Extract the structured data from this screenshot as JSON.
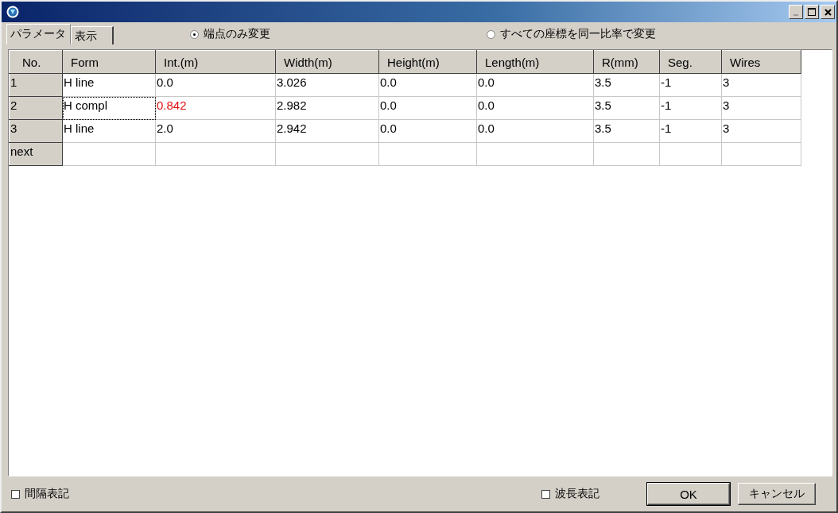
{
  "window": {
    "controls": [
      {
        "kind": "minimize",
        "disabled": true
      },
      {
        "kind": "maximize",
        "disabled": false
      },
      {
        "kind": "close",
        "disabled": false
      }
    ]
  },
  "tabs": [
    {
      "label": "パラメータ",
      "selected": true
    },
    {
      "label": "表示",
      "selected": false
    }
  ],
  "modes": [
    {
      "label": "端点のみ変更",
      "selected": true
    },
    {
      "label": "すべての座標を同一比率で変更",
      "selected": false
    }
  ],
  "table": {
    "columns": [
      "No.",
      "Form",
      "Int.(m)",
      "Width(m)",
      "Height(m)",
      "Length(m)",
      "R(mm)",
      "Seg.",
      "Wires"
    ],
    "rows": [
      {
        "label": "1",
        "cells": [
          {
            "text": "H line",
            "focused": false,
            "highlighted": false
          },
          {
            "text": "0.0",
            "focused": false,
            "highlighted": false
          },
          {
            "text": "3.026",
            "focused": false,
            "highlighted": false
          },
          {
            "text": "0.0",
            "focused": false,
            "highlighted": false
          },
          {
            "text": "0.0",
            "focused": false,
            "highlighted": false
          },
          {
            "text": "3.5",
            "focused": false,
            "highlighted": false
          },
          {
            "text": "-1",
            "focused": false,
            "highlighted": false
          },
          {
            "text": "3",
            "focused": false,
            "highlighted": false
          }
        ]
      },
      {
        "label": "2",
        "cells": [
          {
            "text": "H compl",
            "focused": true,
            "highlighted": false
          },
          {
            "text": "0.842",
            "focused": false,
            "highlighted": true
          },
          {
            "text": "2.982",
            "focused": false,
            "highlighted": false
          },
          {
            "text": "0.0",
            "focused": false,
            "highlighted": false
          },
          {
            "text": "0.0",
            "focused": false,
            "highlighted": false
          },
          {
            "text": "3.5",
            "focused": false,
            "highlighted": false
          },
          {
            "text": "-1",
            "focused": false,
            "highlighted": false
          },
          {
            "text": "3",
            "focused": false,
            "highlighted": false
          }
        ]
      },
      {
        "label": "3",
        "cells": [
          {
            "text": "H line",
            "focused": false,
            "highlighted": false
          },
          {
            "text": "2.0",
            "focused": false,
            "highlighted": false
          },
          {
            "text": "2.942",
            "focused": false,
            "highlighted": false
          },
          {
            "text": "0.0",
            "focused": false,
            "highlighted": false
          },
          {
            "text": "0.0",
            "focused": false,
            "highlighted": false
          },
          {
            "text": "3.5",
            "focused": false,
            "highlighted": false
          },
          {
            "text": "-1",
            "focused": false,
            "highlighted": false
          },
          {
            "text": "3",
            "focused": false,
            "highlighted": false
          }
        ]
      },
      {
        "label": "next"
      }
    ]
  },
  "options": [
    {
      "label": "間隔表記",
      "checked": false
    },
    {
      "label": "波長表記",
      "checked": false
    }
  ],
  "buttons": [
    "OK",
    "キャンセル"
  ]
}
